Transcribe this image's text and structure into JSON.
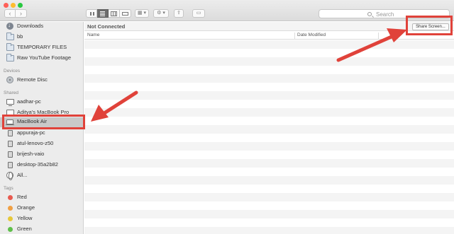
{
  "toolbar": {
    "back_glyph": "‹",
    "forward_glyph": "›",
    "view_modes": [
      "icon-view",
      "list-view",
      "column-view",
      "cover-flow-view"
    ],
    "arrange_glyph": "▦ ▾",
    "action_glyph": "⚙ ▾",
    "share_glyph": "⇪",
    "tag_glyph": "▭",
    "search_placeholder": "Search"
  },
  "sidebar": {
    "favorites": [
      {
        "label": "Downloads",
        "icon": "downloads-icon"
      },
      {
        "label": "bb",
        "icon": "folder-icon"
      },
      {
        "label": "TEMPORARY FILES",
        "icon": "folder-icon"
      },
      {
        "label": "Raw YouTube Footage",
        "icon": "folder-icon"
      }
    ],
    "devices_header": "Devices",
    "devices": [
      {
        "label": "Remote Disc",
        "icon": "disc-icon"
      }
    ],
    "shared_header": "Shared",
    "shared": [
      {
        "label": "aadhar-pc",
        "icon": "display-icon"
      },
      {
        "label": "Aditya's MacBook Pro",
        "icon": "display-icon"
      },
      {
        "label": "MacBook Air",
        "icon": "laptop-icon"
      },
      {
        "label": "appuraja-pc",
        "icon": "display-icon"
      },
      {
        "label": "atul-lenovo-z50",
        "icon": "display-icon"
      },
      {
        "label": "brijesh-vaio",
        "icon": "display-icon"
      },
      {
        "label": "desktop-35a2b82",
        "icon": "display-icon"
      },
      {
        "label": "All...",
        "icon": "globe-icon"
      }
    ],
    "tags_header": "Tags",
    "tags": [
      {
        "label": "Red",
        "color": "#e85a4f"
      },
      {
        "label": "Orange",
        "color": "#f0a044"
      },
      {
        "label": "Yellow",
        "color": "#e6c83a"
      },
      {
        "label": "Green",
        "color": "#5fbf4a"
      }
    ]
  },
  "content": {
    "status": "Not Connected",
    "share_screen_label": "Share Screen...",
    "columns": {
      "name": "Name",
      "date_modified": "Date Modified"
    }
  },
  "annotation_color": "#e0423a"
}
